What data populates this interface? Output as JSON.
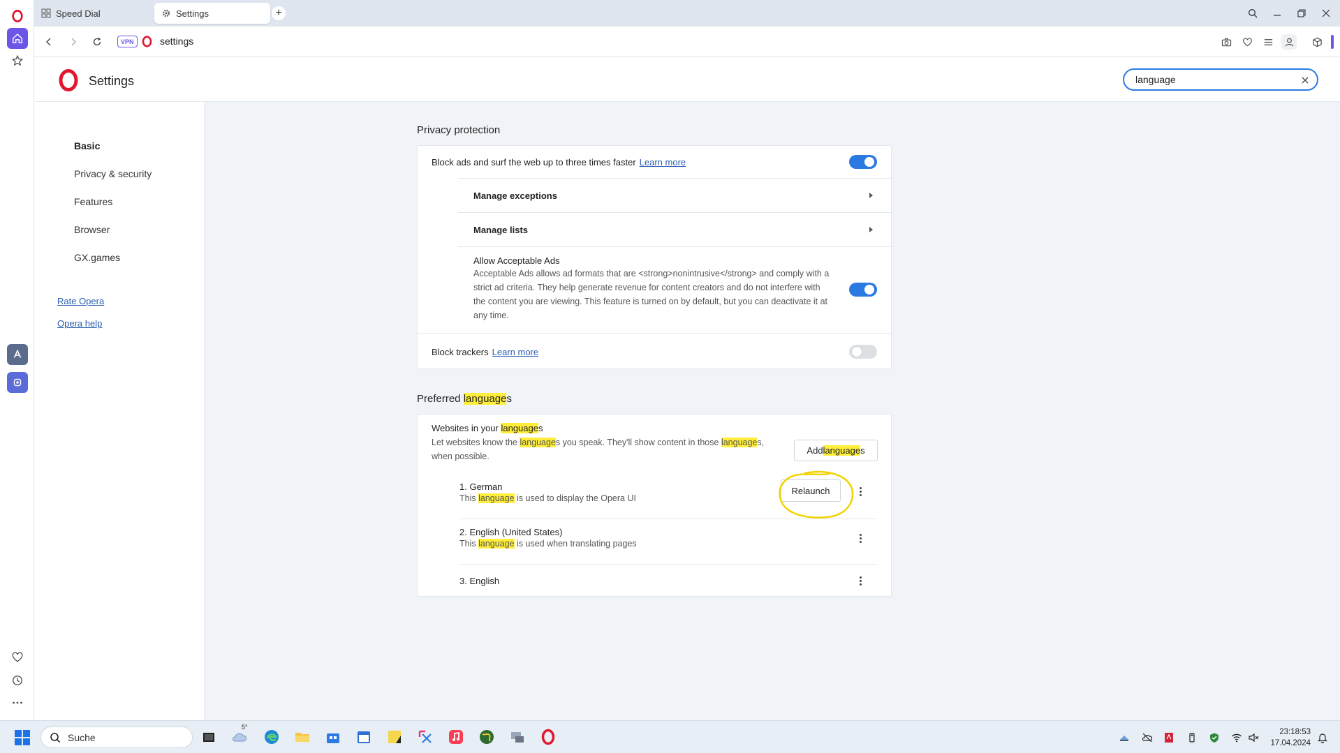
{
  "tabs": [
    {
      "label": "Speed Dial",
      "icon": "speed-dial-icon"
    },
    {
      "label": "Settings",
      "icon": "gear-icon"
    }
  ],
  "address": {
    "vpn_label": "VPN",
    "url": "settings"
  },
  "header": {
    "title": "Settings",
    "search_value": "language"
  },
  "nav": {
    "items": [
      "Basic",
      "Privacy & security",
      "Features",
      "Browser",
      "GX.games"
    ],
    "links": [
      "Rate Opera",
      "Opera help"
    ]
  },
  "privacy": {
    "title": "Privacy protection",
    "block_ads_label": "Block ads and surf the web up to three times faster",
    "block_ads_link": "Learn more",
    "block_ads_enabled": true,
    "manage_exceptions": "Manage exceptions",
    "manage_lists": "Manage lists",
    "acceptable_ads_title": "Allow Acceptable Ads",
    "acceptable_ads_desc": "Acceptable Ads allows ad formats that are <strong>nonintrusive</strong> and comply with a strict ad criteria. They help generate revenue for content creators and do not interfere with the content you are viewing. This feature is turned on by default, but you can deactivate it at any time.",
    "acceptable_ads_enabled": true,
    "block_trackers_label": "Block trackers",
    "block_trackers_link": "Learn more",
    "block_trackers_enabled": false
  },
  "languages": {
    "title_pre": "Preferred ",
    "title_hl": "language",
    "title_post": "s",
    "websites_pre": "Websites in your ",
    "websites_hl": "language",
    "websites_post": "s",
    "desc_1": "Let websites know the ",
    "desc_hl1": "language",
    "desc_2": "s you speak. They'll show content in those ",
    "desc_hl2": "language",
    "desc_3": "s, when possible.",
    "add_pre": "Add ",
    "add_hl": "language",
    "add_post": "s",
    "relaunch_label": "Relaunch",
    "list": [
      {
        "name": "1. German",
        "sub_pre": "This ",
        "sub_hl": "language",
        "sub_post": " is used to display the Opera UI"
      },
      {
        "name": "2. English (United States)",
        "sub_pre": "This ",
        "sub_hl": "language",
        "sub_post": " is used when translating pages"
      },
      {
        "name": "3. English"
      }
    ]
  },
  "taskbar": {
    "search_label": "Suche",
    "weather_temp": "5°",
    "time": "23:18:53",
    "date": "17.04.2024"
  },
  "colors": {
    "accent": "#2a7ae2",
    "highlight": "#ffef3a",
    "opera_red": "#e0182d",
    "annotation": "#f2d300"
  }
}
